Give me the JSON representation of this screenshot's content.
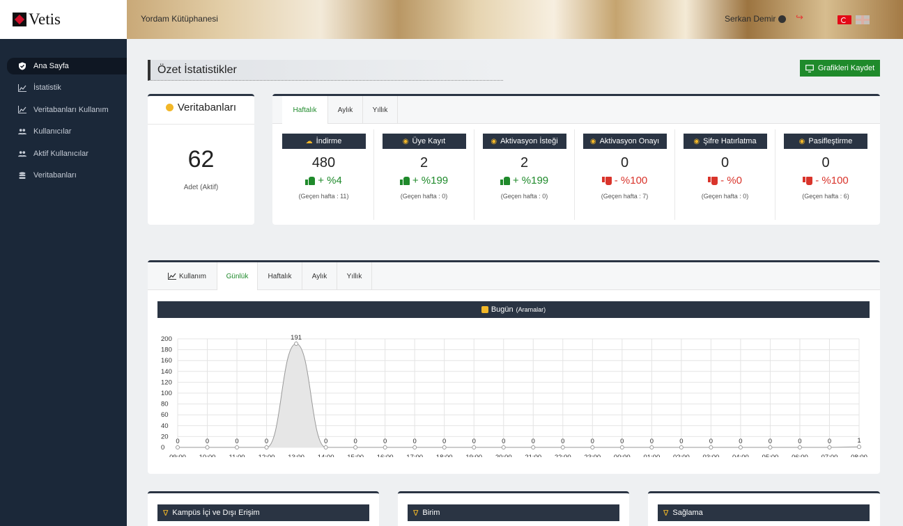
{
  "app": {
    "logo_text": "Vetis"
  },
  "header": {
    "library_name": "Yordam Kütüphanesi",
    "user_name": "Serkan Demir"
  },
  "sidebar": {
    "items": [
      {
        "label": "Ana Sayfa",
        "icon": "shield-check-icon",
        "active": true
      },
      {
        "label": "İstatistik",
        "icon": "area-chart-icon"
      },
      {
        "label": "Veritabanları Kullanım",
        "icon": "area-chart-icon"
      },
      {
        "label": "Kullanıcılar",
        "icon": "users-icon"
      },
      {
        "label": "Aktif Kullanıcılar",
        "icon": "users-icon"
      },
      {
        "label": "Veritabanları",
        "icon": "database-icon"
      }
    ]
  },
  "page": {
    "title": "Özet İstatistikler",
    "save_button_label": "Grafikleri Kaydet"
  },
  "db_card": {
    "title": "Veritabanları",
    "count": "62",
    "subtitle": "Adet (Aktif)"
  },
  "stats": {
    "tabs": [
      "Haftalık",
      "Aylık",
      "Yıllık"
    ],
    "active_tab": "Haftalık",
    "items": [
      {
        "title": "İndirme",
        "value": "480",
        "trend": "+ %4",
        "direction": "up",
        "prev": "(Geçen hafta : 11)"
      },
      {
        "title": "Üye Kayıt",
        "value": "2",
        "trend": "+ %199",
        "direction": "up",
        "prev": "(Geçen hafta : 0)"
      },
      {
        "title": "Aktivasyon İsteği",
        "value": "2",
        "trend": "+ %199",
        "direction": "up",
        "prev": "(Geçen hafta : 0)"
      },
      {
        "title": "Aktivasyon Onayı",
        "value": "0",
        "trend": "- %100",
        "direction": "down",
        "prev": "(Geçen hafta : 7)"
      },
      {
        "title": "Şifre Hatırlatma",
        "value": "0",
        "trend": "- %0",
        "direction": "down",
        "prev": "(Geçen hafta : 0)"
      },
      {
        "title": "Pasifleştirme",
        "value": "0",
        "trend": "- %100",
        "direction": "down",
        "prev": "(Geçen hafta : 6)"
      }
    ]
  },
  "usage": {
    "tabs": [
      "Kullanım",
      "Günlük",
      "Haftalık",
      "Aylık",
      "Yıllık"
    ],
    "active_tab": "Günlük",
    "chart_title": "Bugün",
    "chart_title_sub": "(Aramalar)"
  },
  "chart_data": {
    "type": "area",
    "title": "Bugün (Aramalar)",
    "categories": [
      "09:00",
      "10:00",
      "11:00",
      "12:00",
      "13:00",
      "14:00",
      "15:00",
      "16:00",
      "17:00",
      "18:00",
      "19:00",
      "20:00",
      "21:00",
      "22:00",
      "23:00",
      "00:00",
      "01:00",
      "02:00",
      "03:00",
      "04:00",
      "05:00",
      "06:00",
      "07:00",
      "08:00"
    ],
    "values": [
      0,
      0,
      0,
      0,
      191,
      0,
      0,
      0,
      0,
      0,
      0,
      0,
      0,
      0,
      0,
      0,
      0,
      0,
      0,
      0,
      0,
      0,
      0,
      1
    ],
    "ylim": [
      0,
      200
    ],
    "yticks": [
      0,
      20,
      40,
      60,
      80,
      100,
      120,
      140,
      160,
      180,
      200
    ],
    "grid": true,
    "fill_color": "#e6e6e6",
    "line_color": "#999999"
  },
  "bottom_cards": [
    {
      "title": "Kampüs İçi ve Dışı Erişim"
    },
    {
      "title": "Birim"
    },
    {
      "title": "Sağlama"
    }
  ],
  "colors": {
    "sidebar_bg": "#1b2839",
    "accent_green": "#1f8a2b",
    "accent_red": "#d9342b",
    "dark_head": "#2a3443",
    "gold": "#f2b728"
  }
}
